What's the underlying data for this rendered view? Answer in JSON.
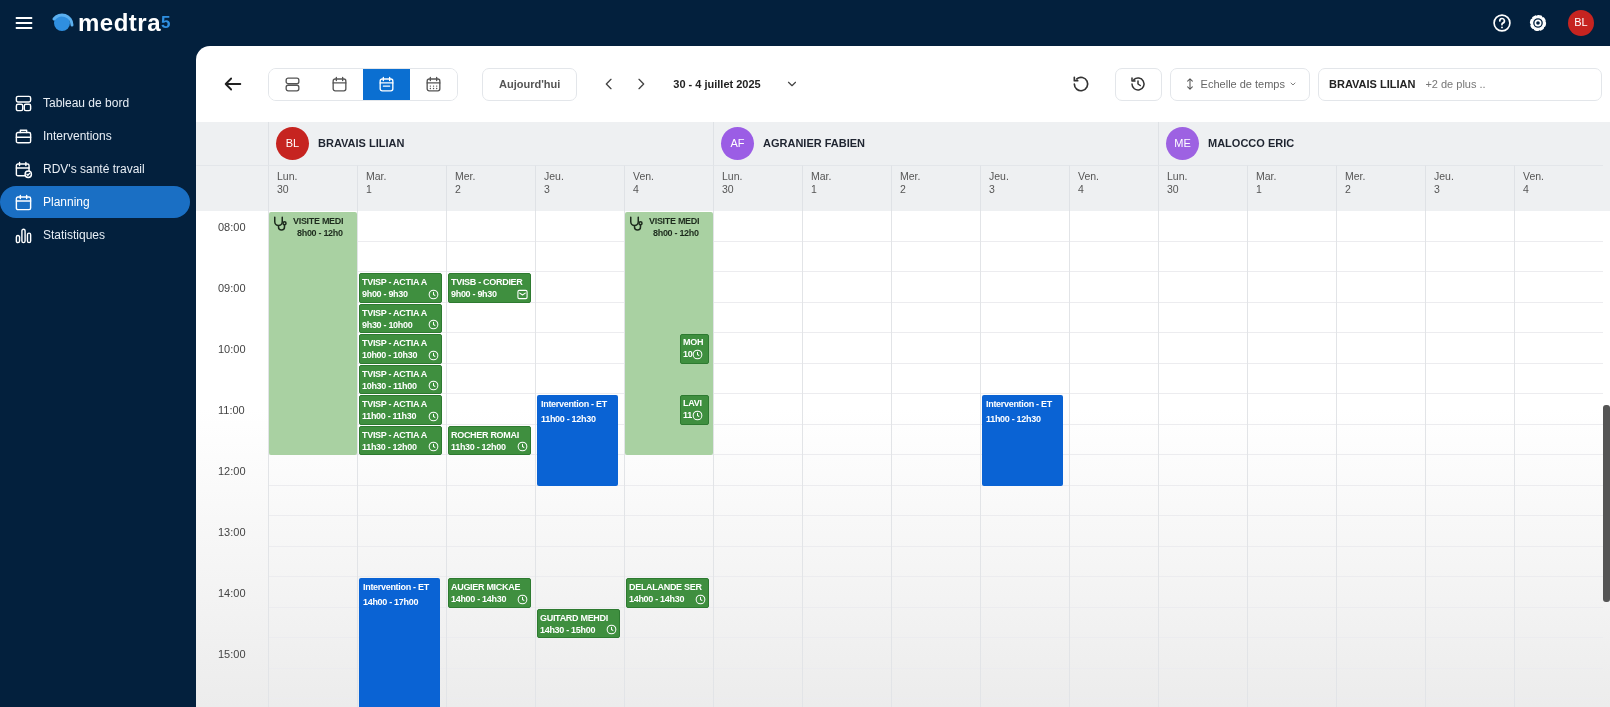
{
  "topbar": {
    "logo": {
      "text": "medtra",
      "suffix": "5"
    },
    "avatar": {
      "initials": "BL",
      "color": "#c62420"
    }
  },
  "sidebar": {
    "items": [
      {
        "label": "Tableau de bord",
        "kind": "dashboard",
        "selected": false
      },
      {
        "label": "Interventions",
        "kind": "briefcase",
        "selected": false
      },
      {
        "label": "RDV's santé travail",
        "kind": "appointments",
        "selected": false
      },
      {
        "label": "Planning",
        "kind": "planning",
        "selected": true
      },
      {
        "label": "Statistiques",
        "kind": "stats",
        "selected": false
      }
    ]
  },
  "toolbar": {
    "views": [
      {
        "kind": "agenda",
        "selected": false
      },
      {
        "kind": "day",
        "selected": false
      },
      {
        "kind": "week",
        "selected": true
      },
      {
        "kind": "month",
        "selected": false
      }
    ],
    "today_button": "Aujourd'hui",
    "date_range": "30 - 4 juillet 2025",
    "time_scale_button": "Echelle de temps",
    "people_field": {
      "value": "BRAVAIS LILIAN",
      "more": "+2 de plus .."
    }
  },
  "planning": {
    "hours": [
      "08:00",
      "09:00",
      "10:00",
      "11:00",
      "12:00",
      "13:00",
      "14:00",
      "15:00"
    ],
    "people": [
      {
        "initials": "BL",
        "name": "BRAVAIS LILIAN",
        "color": "#c62420",
        "days": [
          {
            "weekday": "Lun.",
            "date": "30",
            "events": [
              {
                "kind": "visit",
                "title": "VISITE MEDI",
                "time": "8h00 - 12h0"
              }
            ]
          },
          {
            "weekday": "Mar.",
            "date": "1",
            "events": [
              {
                "kind": "appointment",
                "title": "TVISP - ACTIA A",
                "time": "9h00 - 9h30"
              },
              {
                "kind": "appointment",
                "title": "TVISP - ACTIA A",
                "time": "9h30 - 10h00"
              },
              {
                "kind": "appointment",
                "title": "TVISP - ACTIA A",
                "time": "10h00 - 10h30"
              },
              {
                "kind": "appointment",
                "title": "TVISP - ACTIA A",
                "time": "10h30 - 11h00"
              },
              {
                "kind": "appointment",
                "title": "TVISP - ACTIA A",
                "time": "11h00 - 11h30"
              },
              {
                "kind": "appointment",
                "title": "TVISP - ACTIA A",
                "time": "11h30 - 12h00"
              },
              {
                "kind": "intervention",
                "title": "Intervention - ET",
                "time": "14h00 - 17h00"
              }
            ]
          },
          {
            "weekday": "Mer.",
            "date": "2",
            "events": [
              {
                "kind": "message",
                "title": "TVISB - CORDIER",
                "time": "9h00 - 9h30"
              },
              {
                "kind": "appointment",
                "title": "ROCHER ROMAI",
                "time": "11h30 - 12h00"
              },
              {
                "kind": "appointment",
                "title": "AUGIER MICKAE",
                "time": "14h00 - 14h30"
              }
            ]
          },
          {
            "weekday": "Jeu.",
            "date": "3",
            "events": [
              {
                "kind": "intervention",
                "title": "Intervention - ET",
                "time": "11h00 - 12h30"
              },
              {
                "kind": "appointment",
                "title": "GUITARD MEHDI",
                "time": "14h30 - 15h00"
              }
            ]
          },
          {
            "weekday": "Ven.",
            "date": "4",
            "events": [
              {
                "kind": "visit",
                "title": "VISITE MEDI",
                "time": "8h00 - 12h0"
              },
              {
                "kind": "mini",
                "title": "MOH",
                "time": "10"
              },
              {
                "kind": "mini",
                "title": "LAVI",
                "time": "11"
              },
              {
                "kind": "appointment",
                "title": "DELALANDE SER",
                "time": "14h00 - 14h30"
              }
            ]
          }
        ]
      },
      {
        "initials": "AF",
        "name": "AGRANIER FABIEN",
        "color": "#9b5de5",
        "days": [
          {
            "weekday": "Lun.",
            "date": "30"
          },
          {
            "weekday": "Mar.",
            "date": "1"
          },
          {
            "weekday": "Mer.",
            "date": "2"
          },
          {
            "weekday": "Jeu.",
            "date": "3",
            "events": [
              {
                "kind": "intervention",
                "title": "Intervention - ET",
                "time": "11h00 - 12h30"
              }
            ]
          },
          {
            "weekday": "Ven.",
            "date": "4"
          }
        ]
      },
      {
        "initials": "ME",
        "name": "MALOCCO ERIC",
        "color": "#9d62e2",
        "days": [
          {
            "weekday": "Lun.",
            "date": "30"
          },
          {
            "weekday": "Mar.",
            "date": "1"
          },
          {
            "weekday": "Mer.",
            "date": "2"
          },
          {
            "weekday": "Jeu.",
            "date": "3"
          },
          {
            "weekday": "Ven.",
            "date": "4"
          }
        ]
      }
    ]
  }
}
